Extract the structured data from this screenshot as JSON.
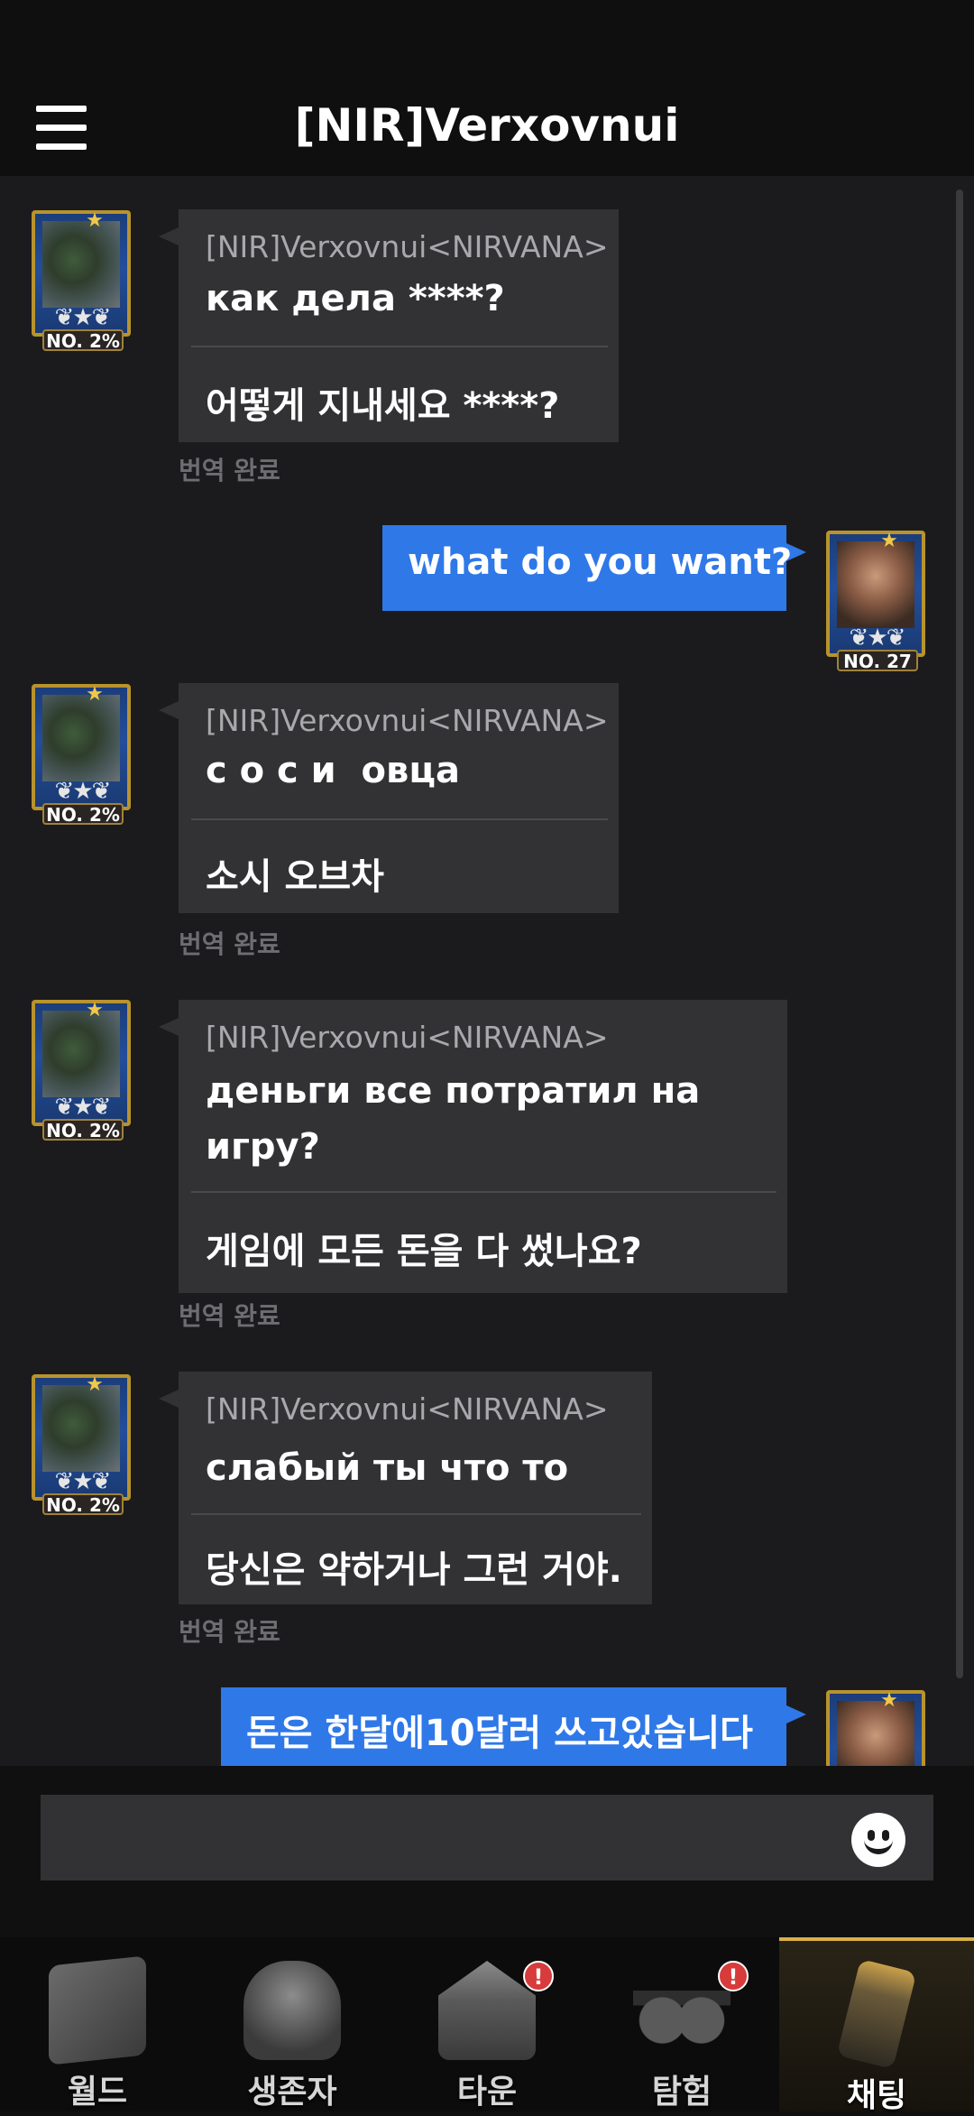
{
  "header": {
    "title": "[NIR]Verxovnui",
    "menu_icon": "hamburger-menu-icon"
  },
  "messages": [
    {
      "side": "left",
      "sender": "[NIR]Verxovnui<NIRVANA>",
      "original": "как дела ****?",
      "translation": "어떻게 지내세요 ****?",
      "status": "번역 완료",
      "rank": "NO. 2%"
    },
    {
      "side": "right",
      "text": "what do you want?",
      "rank": "NO. 27"
    },
    {
      "side": "left",
      "sender": "[NIR]Verxovnui<NIRVANA>",
      "original": "с о с и  овца",
      "translation": "소시 오브차",
      "status": "번역 완료",
      "rank": "NO. 2%"
    },
    {
      "side": "left",
      "sender": "[NIR]Verxovnui<NIRVANA>",
      "original": "деньги все потратил на игру?",
      "translation": "게임에 모든 돈을 다 썼나요?",
      "status": "번역 완료",
      "rank": "NO. 2%"
    },
    {
      "side": "left",
      "sender": "[NIR]Verxovnui<NIRVANA>",
      "original": "слабый ты что то",
      "translation": "당신은 약하거나 그런 거야.",
      "status": "번역 완료",
      "rank": "NO. 2%"
    },
    {
      "side": "right",
      "text": "돈은 한달에10달러 쓰고있습니다"
    }
  ],
  "input": {
    "placeholder": "",
    "emoji_icon": "smiley-icon"
  },
  "nav": [
    {
      "label": "월드",
      "icon": "world-map-icon",
      "badge": ""
    },
    {
      "label": "생존자",
      "icon": "survivor-icon",
      "badge": ""
    },
    {
      "label": "타운",
      "icon": "town-icon",
      "badge": "!"
    },
    {
      "label": "탐험",
      "icon": "binoculars-icon",
      "badge": "!"
    },
    {
      "label": "채팅",
      "icon": "walkie-talkie-icon",
      "badge": "",
      "active": true
    }
  ]
}
